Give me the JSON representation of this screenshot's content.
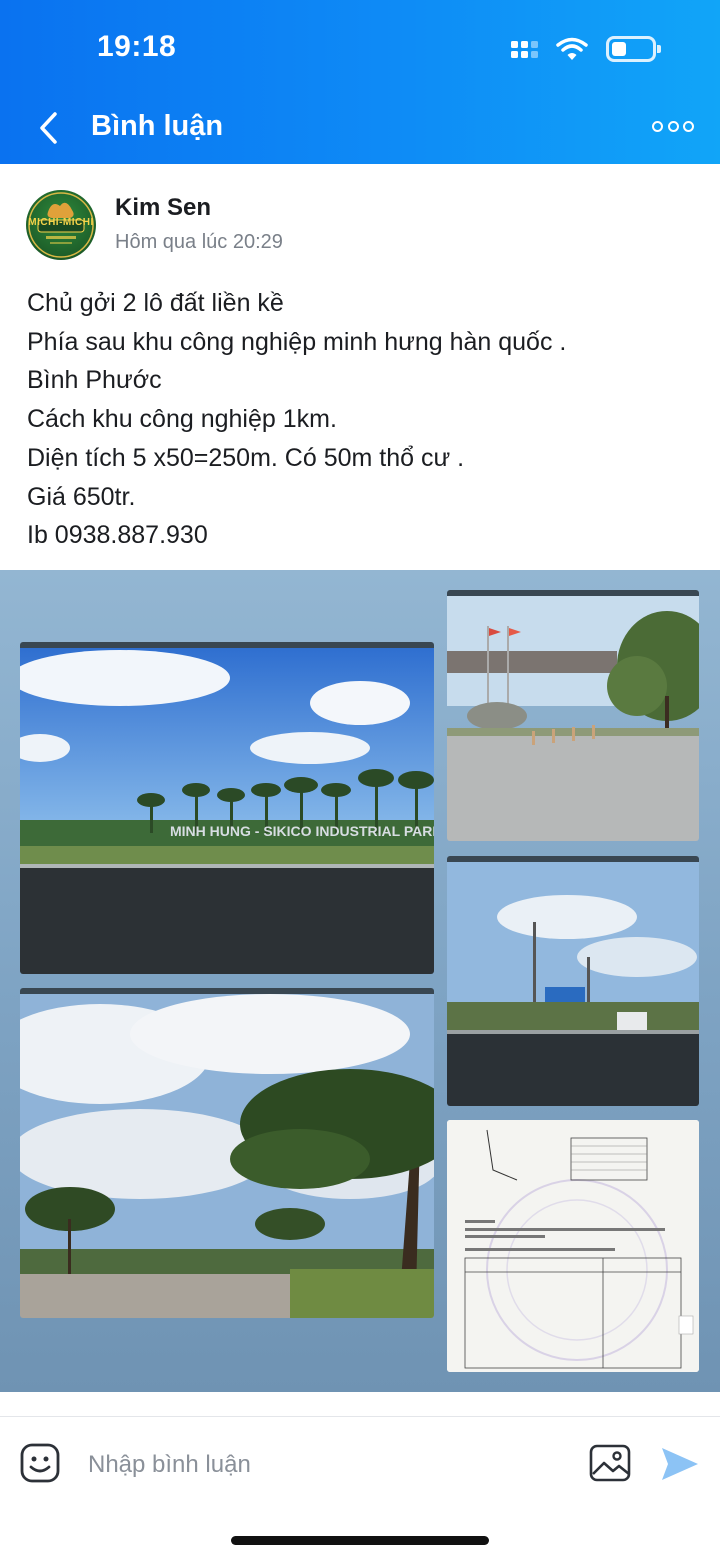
{
  "status_bar": {
    "time": "19:18"
  },
  "header": {
    "title": "Bình luận"
  },
  "post": {
    "author": "Kim Sen",
    "avatar_text": "MICHI-MICHI",
    "timestamp": "Hôm qua lúc 20:29",
    "lines": [
      "Chủ gởi 2 lô đất liền kề",
      "Phía sau khu công nghiệp minh hưng hàn quốc .",
      "Bình Phước",
      "Cách khu công nghiệp 1km.",
      "Diện tích 5 x50=250m. Có 50m thổ cư .",
      "Giá 650tr.",
      "Ib 0938.887.930"
    ],
    "photos": {
      "industrial_park_sign": "MINH HUNG - SIKICO INDUSTRIAL PARK"
    }
  },
  "comment_bar": {
    "placeholder": "Nhập bình luận"
  },
  "colors": {
    "header_start": "#0a72f0",
    "header_end": "#11a5f8",
    "send_icon": "#8cc3f5",
    "text_primary": "#1b1d21",
    "text_secondary": "#7a8089"
  }
}
